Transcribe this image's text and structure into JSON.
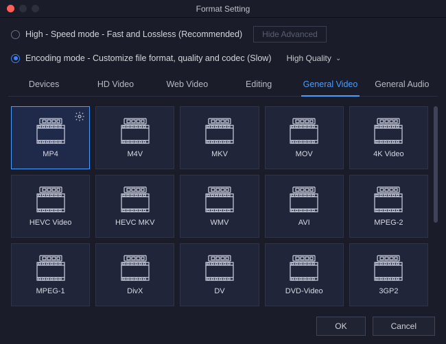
{
  "window": {
    "title": "Format Setting"
  },
  "modes": {
    "high_speed": {
      "label": "High - Speed mode - Fast and Lossless (Recommended)",
      "selected": false
    },
    "encoding": {
      "label": "Encoding mode - Customize file format, quality and codec (Slow)",
      "selected": true
    },
    "hide_advanced": "Hide Advanced",
    "quality": {
      "value": "High Quality"
    }
  },
  "tabs": [
    {
      "label": "Devices",
      "active": false
    },
    {
      "label": "HD Video",
      "active": false
    },
    {
      "label": "Web Video",
      "active": false
    },
    {
      "label": "Editing",
      "active": false
    },
    {
      "label": "General Video",
      "active": true
    },
    {
      "label": "General Audio",
      "active": false
    }
  ],
  "formats": [
    {
      "label": "MP4",
      "selected": true
    },
    {
      "label": "M4V",
      "selected": false
    },
    {
      "label": "MKV",
      "selected": false
    },
    {
      "label": "MOV",
      "selected": false
    },
    {
      "label": "4K Video",
      "selected": false
    },
    {
      "label": "HEVC Video",
      "selected": false
    },
    {
      "label": "HEVC MKV",
      "selected": false
    },
    {
      "label": "WMV",
      "selected": false
    },
    {
      "label": "AVI",
      "selected": false
    },
    {
      "label": "MPEG-2",
      "selected": false
    },
    {
      "label": "MPEG-1",
      "selected": false
    },
    {
      "label": "DivX",
      "selected": false
    },
    {
      "label": "DV",
      "selected": false
    },
    {
      "label": "DVD-Video",
      "selected": false
    },
    {
      "label": "3GP2",
      "selected": false
    }
  ],
  "footer": {
    "ok": "OK",
    "cancel": "Cancel"
  }
}
